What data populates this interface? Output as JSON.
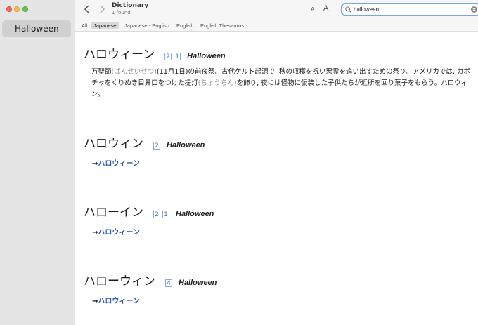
{
  "window": {
    "title": "Dictionary",
    "subtitle": "1 found"
  },
  "sidebar": {
    "items": [
      {
        "label": "Halloween"
      }
    ]
  },
  "toolbar": {
    "font_small": "A",
    "font_large": "A",
    "search_value": "halloween"
  },
  "tabs": [
    {
      "label": "All"
    },
    {
      "label": "Japanese"
    },
    {
      "label": "Japanese - English"
    },
    {
      "label": "English"
    },
    {
      "label": "English Thesaurus"
    }
  ],
  "entries": [
    {
      "headword": "ハロウィーン",
      "numbers": [
        "2",
        "1"
      ],
      "english": "Halloween",
      "definition": {
        "part1": "万聖節",
        "reading1": "(ばんせいせつ)",
        "part2": "(11月1日)の前夜祭。古代ケルト起源で, 秋の収穫を祝い悪霊を追い出すための祭り。アメリカでは, カボチャをくりぬき目鼻口をつけた提灯",
        "reading2": "(ちょうちん)",
        "part3": "を飾り, 夜には怪物に仮装した子供たちが近所を回り菓子をもらう。ハロウィン。"
      }
    },
    {
      "headword": "ハロウィン",
      "numbers": [
        "2"
      ],
      "english": "Halloween",
      "arrow": "→",
      "xref": "ハロウィーン"
    },
    {
      "headword": "ハローイン",
      "numbers": [
        "2",
        "1"
      ],
      "english": "Halloween",
      "arrow": "→",
      "xref": "ハロウィーン"
    },
    {
      "headword": "ハローウィン",
      "numbers": [
        "4"
      ],
      "english": "Halloween",
      "arrow": "→",
      "xref": "ハロウィーン"
    }
  ],
  "colors": {
    "accent": "#2a59b5",
    "sidebar_bg": "#e6e5e5",
    "selection": "#d1d0d0"
  }
}
